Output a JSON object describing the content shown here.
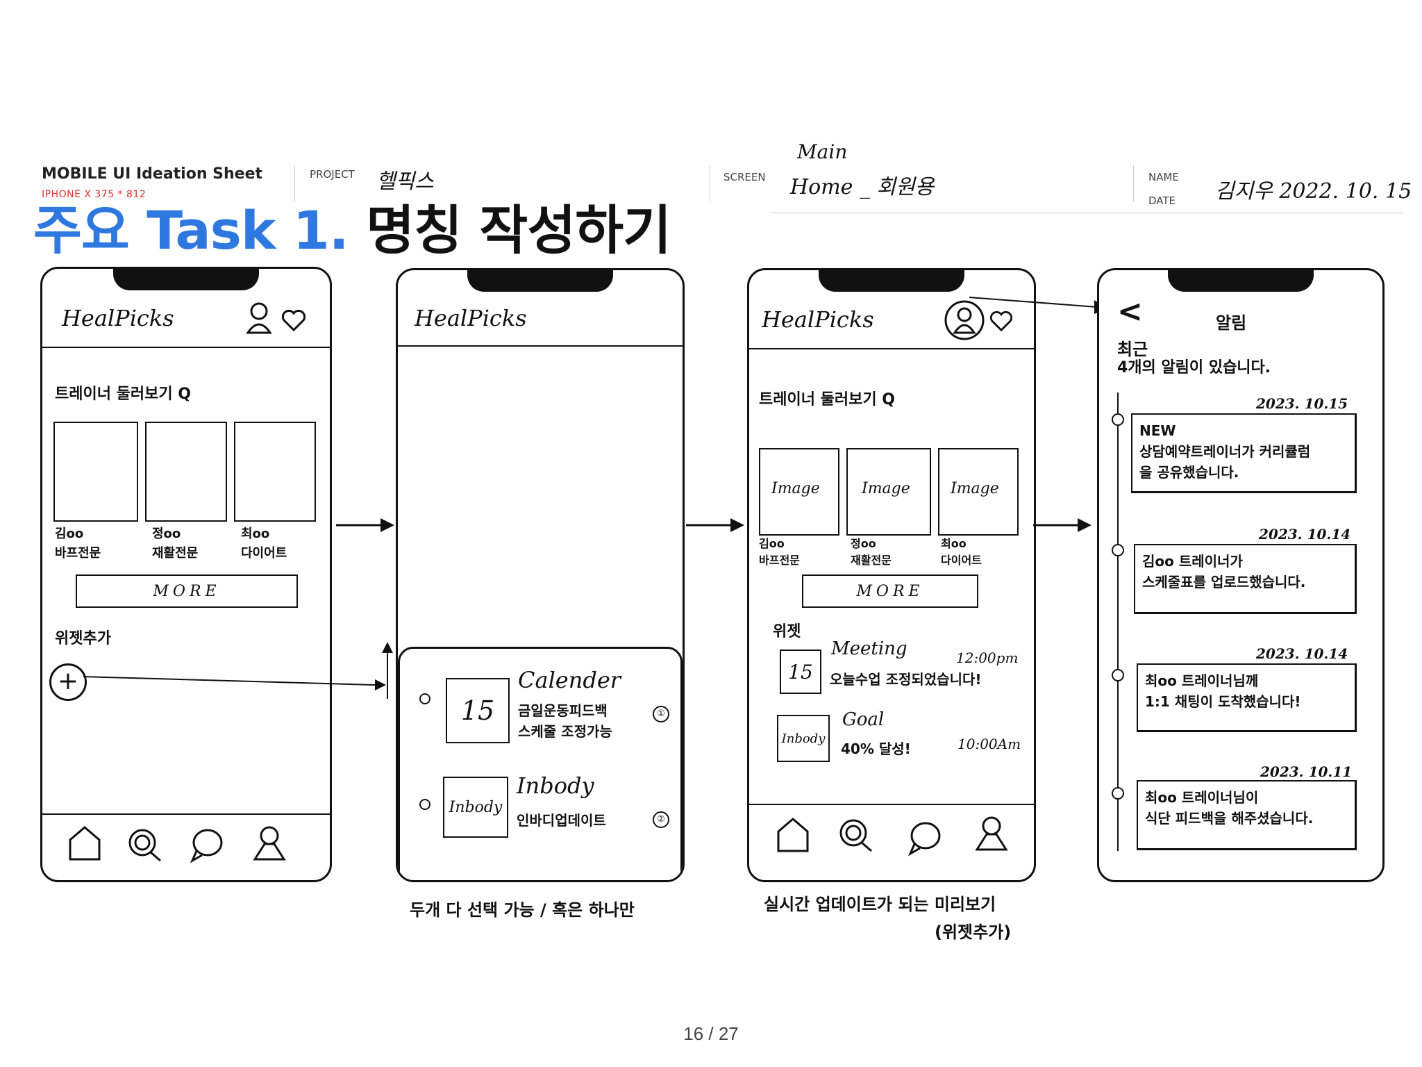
{
  "sheet": {
    "title": "MOBILE UI Ideation Sheet",
    "subtitle": "IPHONE X 375 * 812",
    "project_label": "PROJECT",
    "project_value": "헬픽스",
    "screen_label": "SCREEN",
    "screen_value_top": "Main",
    "screen_value": "Home _ 회원용",
    "name_label": "NAME",
    "date_label": "DATE",
    "name_date_value": "김지우 2022. 10. 15"
  },
  "task": {
    "prefix": "주요 Task 1.",
    "title": "명칭 작성하기"
  },
  "screen1": {
    "app_title": "HealPicks",
    "browse_label": "트레이너 둘러보기 Q",
    "trainers": [
      {
        "name": "김oo",
        "spec": "바프전문"
      },
      {
        "name": "정oo",
        "spec": "재활전문"
      },
      {
        "name": "최oo",
        "spec": "다이어트"
      }
    ],
    "more_label": "MORE",
    "widget_add_label": "위젯추가",
    "plus_symbol": "+"
  },
  "screen2": {
    "app_title": "HealPicks",
    "widgets": [
      {
        "title": "Calender",
        "icon_text": "15",
        "desc_line1": "금일운동피드백",
        "desc_line2": "스케줄 조정가능",
        "num": "①"
      },
      {
        "title": "Inbody",
        "icon_text": "Inbody",
        "desc_line1": "인바디업데이트",
        "desc_line2": "",
        "num": "②"
      }
    ],
    "caption": "두개 다 선택 가능 / 혹은 하나만"
  },
  "screen3": {
    "app_title": "HealPicks",
    "browse_label": "트레이너 둘러보기 Q",
    "image_label": "Image",
    "trainers": [
      {
        "name": "김oo",
        "spec": "바프전문"
      },
      {
        "name": "정oo",
        "spec": "재활전문"
      },
      {
        "name": "최oo",
        "spec": "다이어트"
      }
    ],
    "more_label": "MORE",
    "widget_label": "위젯",
    "widgets": [
      {
        "title": "Meeting",
        "icon_text": "15",
        "time": "12:00pm",
        "desc": "오늘수업 조정되었습니다!"
      },
      {
        "title": "Goal",
        "icon_text": "Inbody",
        "time": "10:00Am",
        "desc": "40% 달성!"
      }
    ],
    "caption_line1": "실시간 업데이트가 되는 미리보기",
    "caption_line2": "(위젯추가)"
  },
  "screen4": {
    "back_symbol": "<",
    "title": "알림",
    "summary_line1": "최근",
    "summary_line2": "4개의 알림이 있습니다.",
    "notifications": [
      {
        "date": "2023. 10.15",
        "line1": "NEW",
        "line2": "상담예약트레이너가 커리큘럼",
        "line3": "을 공유했습니다."
      },
      {
        "date": "2023. 10.14",
        "line1": "김oo 트레이너가",
        "line2": "스케줄표를 업로드했습니다.",
        "line3": ""
      },
      {
        "date": "2023. 10.14",
        "line1": "최oo 트레이너님께",
        "line2": "1:1 채팅이 도착했습니다!",
        "line3": ""
      },
      {
        "date": "2023. 10.11",
        "line1": "최oo 트레이너님이",
        "line2": "식단 피드백을 해주셨습니다.",
        "line3": ""
      }
    ]
  },
  "footer": {
    "page": "16 / 27"
  },
  "colors": {
    "accent_blue": "#2e78e0",
    "subtitle_red": "#d33333",
    "ink": "#111111"
  }
}
